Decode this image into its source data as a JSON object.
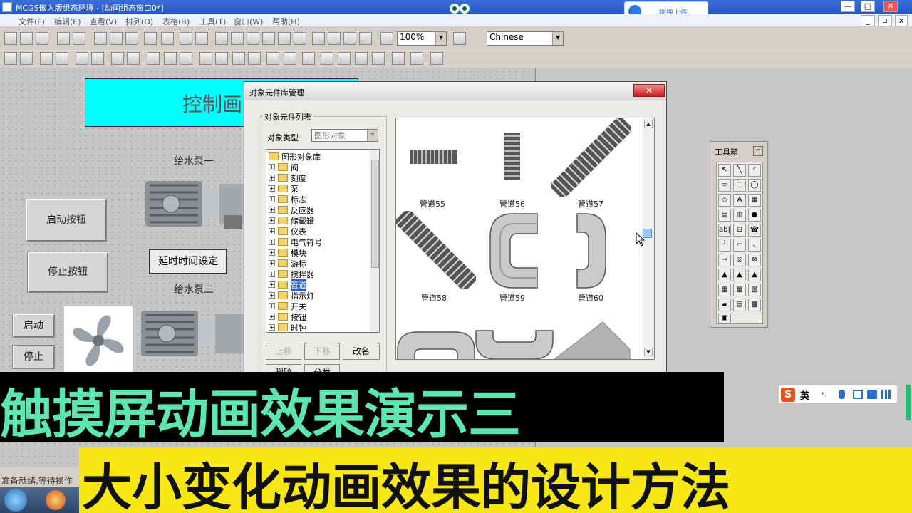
{
  "app": {
    "window_title": "MCGS嵌入版组态环境 - [动画组态窗口0*]",
    "upload_text": "拖拽上传",
    "win_controls": [
      "—",
      "□",
      "✕"
    ]
  },
  "menu": [
    "文件(F)",
    "编辑(E)",
    "查看(V)",
    "排列(D)",
    "表格(B)",
    "工具(T)",
    "窗口(W)",
    "帮助(H)"
  ],
  "toolbar": {
    "zoom": "100%",
    "language": "Chinese"
  },
  "canvas": {
    "title_text": "控制画",
    "pump1_label": "给水泵一",
    "pump2_label": "给水泵二",
    "start_button": "启动按钮",
    "stop_button": "停止按钮",
    "delay_button": "延时时间设定",
    "start_small": "启动",
    "stop_small": "停止"
  },
  "dialog": {
    "title": "对象元件库管理",
    "close": "✕",
    "list_group": "对象元件列表",
    "type_label": "对象类型",
    "type_value": "图形对象",
    "tree_root": "图形对象库",
    "tree_items": [
      "阀",
      "刻度",
      "泵",
      "标志",
      "反应器",
      "储藏罐",
      "仪表",
      "电气符号",
      "模块",
      "游标",
      "搅拌器",
      "管道",
      "指示灯",
      "开关",
      "按钮",
      "时钟"
    ],
    "selected_item": "管道",
    "btn_up": "上移",
    "btn_down": "下移",
    "btn_rename": "改名",
    "btn_delete": "删除",
    "btn_split": "分类",
    "previews": [
      "管道55",
      "管道56",
      "管道57",
      "管道58",
      "管道59",
      "管道60"
    ]
  },
  "toolbox": {
    "title": "工具箱",
    "tools": [
      "↖",
      "╲",
      "◜",
      "▭",
      "▢",
      "◯",
      "◇",
      "A",
      "▦",
      "▤",
      "▥",
      "●",
      "ab|",
      "⊟",
      "☎",
      "┘",
      "⌐",
      "◟",
      "⊸",
      "◎",
      "⊗",
      "▲",
      "▲",
      "▲",
      "▦",
      "▦",
      "▧",
      "▰",
      "▤",
      "▩",
      "▣"
    ]
  },
  "status": "准备就绪,等待操作",
  "captions": {
    "line1": "触摸屏动画效果演示三",
    "line2": "大小变化动画效果的设计方法"
  },
  "ime": {
    "logo": "S",
    "mode": "英"
  }
}
